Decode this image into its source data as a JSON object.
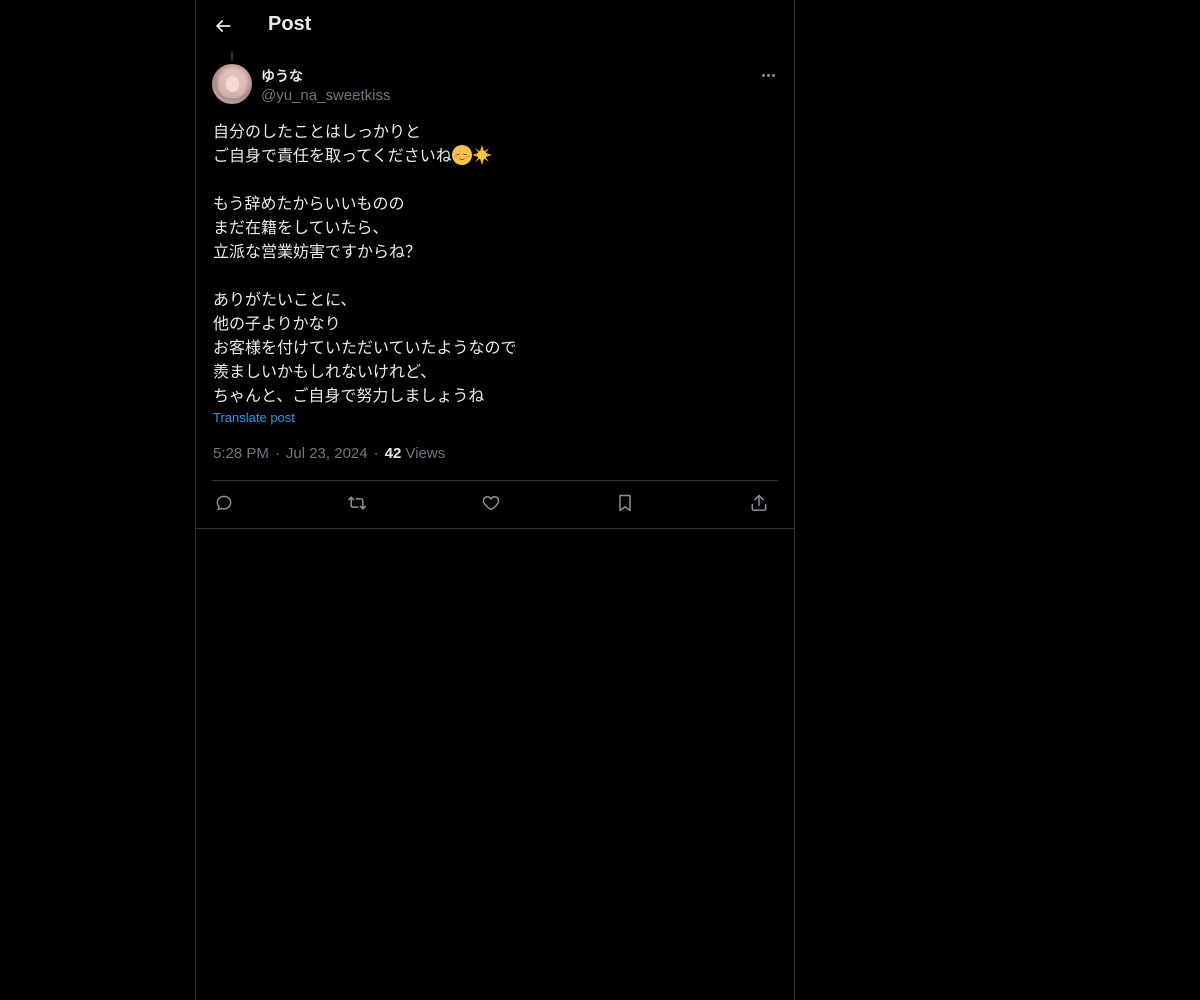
{
  "header": {
    "title": "Post"
  },
  "post": {
    "author": {
      "display_name": "ゆうな",
      "handle": "@yu_na_sweetkiss"
    },
    "lines": [
      "自分のしたことはしっかりと",
      "ご自身で責任を取ってくださいね",
      "",
      "もう辞めたからいいものの",
      "まだ在籍をしていたら、",
      "立派な営業妨害ですからね？",
      "",
      "ありがたいことに、",
      "他の子よりかなり",
      "お客様を付けていただいていたようなので",
      "羨ましいかもしれないけれど、",
      "ちゃんと、ご自身で努力しましょうね"
    ],
    "emojis": [
      "relieved-face-emoji",
      "sun-emoji"
    ],
    "translate_label": "Translate post",
    "time": "5:28 PM",
    "separator": "·",
    "date": "Jul 23, 2024",
    "views_count": "42",
    "views_label": "Views"
  },
  "actions": [
    "reply-icon",
    "repost-icon",
    "like-icon",
    "bookmark-icon",
    "share-icon"
  ],
  "colors": {
    "background": "#000000",
    "text": "#e7e9ea",
    "muted": "#71767b",
    "link": "#1d9bf0",
    "border": "#2f3336"
  }
}
